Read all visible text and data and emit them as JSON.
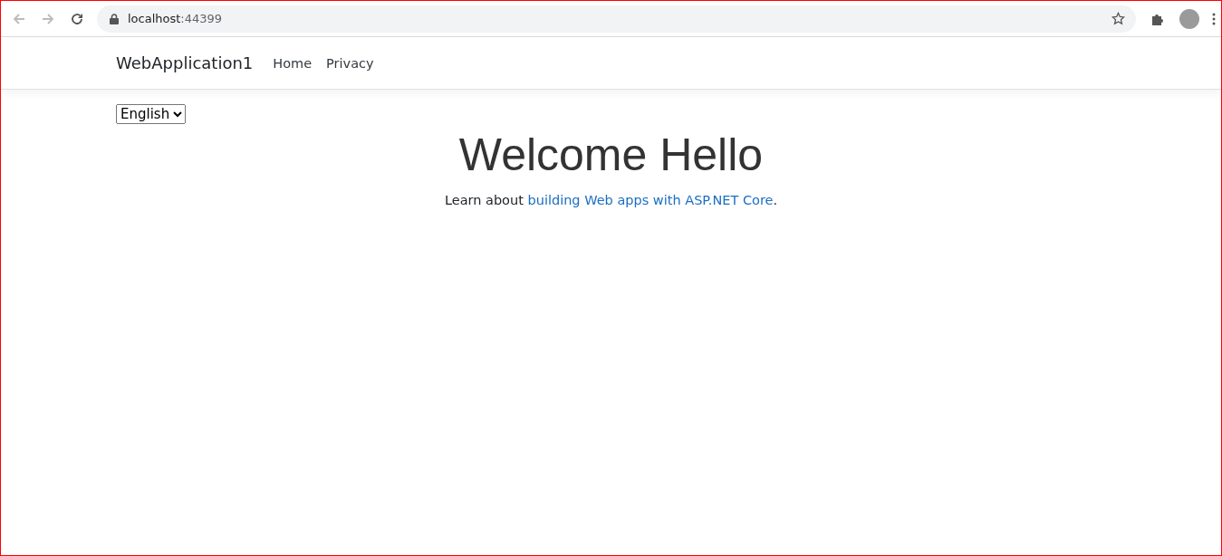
{
  "browser": {
    "address": "localhost",
    "port": ":44399"
  },
  "navbar": {
    "brand": "WebApplication1",
    "links": [
      {
        "label": "Home"
      },
      {
        "label": "Privacy"
      }
    ]
  },
  "language_select": {
    "value": "English"
  },
  "heading": "Welcome Hello",
  "intro": {
    "before": "Learn about ",
    "link": "building Web apps with ASP.NET Core",
    "after": "."
  }
}
